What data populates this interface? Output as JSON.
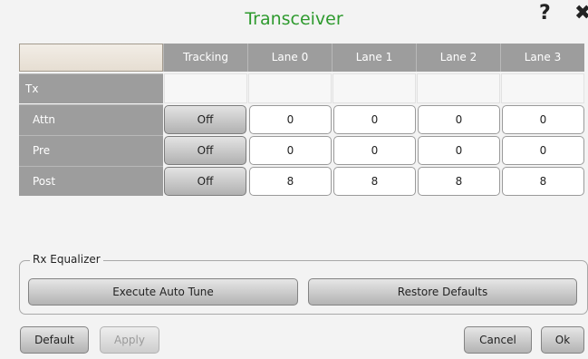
{
  "dialog": {
    "title": "Transceiver",
    "help_glyph": "?",
    "close_glyph": "✖"
  },
  "table": {
    "columns": [
      "Tracking",
      "Lane 0",
      "Lane 1",
      "Lane 2",
      "Lane 3"
    ],
    "section": "Tx",
    "rows": [
      {
        "label": "Attn",
        "tracking": "Off",
        "lanes": [
          "0",
          "0",
          "0",
          "0"
        ]
      },
      {
        "label": "Pre",
        "tracking": "Off",
        "lanes": [
          "0",
          "0",
          "0",
          "0"
        ]
      },
      {
        "label": "Post",
        "tracking": "Off",
        "lanes": [
          "8",
          "8",
          "8",
          "8"
        ]
      }
    ]
  },
  "rx_equalizer": {
    "legend": "Rx Equalizer",
    "execute_label": "Execute Auto Tune",
    "restore_label": "Restore Defaults"
  },
  "footer": {
    "default_label": "Default",
    "apply_label": "Apply",
    "cancel_label": "Cancel",
    "ok_label": "Ok"
  }
}
